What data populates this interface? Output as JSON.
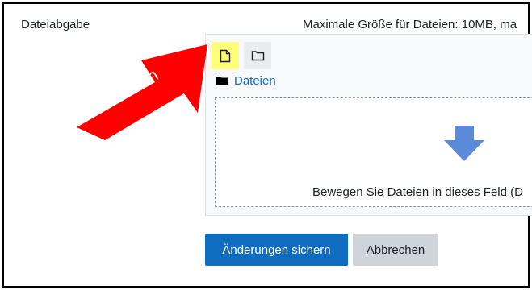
{
  "form": {
    "field_label": "Dateiabgabe",
    "max_size_text": "Maximale Größe für Dateien: 10MB, ma"
  },
  "filepicker": {
    "toolbar": {
      "add_file_icon": "file-icon",
      "create_folder_icon": "folder-icon",
      "highlight_color": "#ffff7a"
    },
    "breadcrumb": {
      "folder_icon": "folder-filled-icon",
      "label": "Dateien"
    },
    "dropzone": {
      "icon": "down-arrow-icon",
      "text": "Bewegen Sie Dateien in dieses Feld (D"
    }
  },
  "buttons": {
    "save_label": "Änderungen sichern",
    "cancel_label": "Abbrechen",
    "primary_color": "#0f6cbf"
  },
  "annotation": {
    "text": "klicken",
    "color": "#ff0000"
  }
}
